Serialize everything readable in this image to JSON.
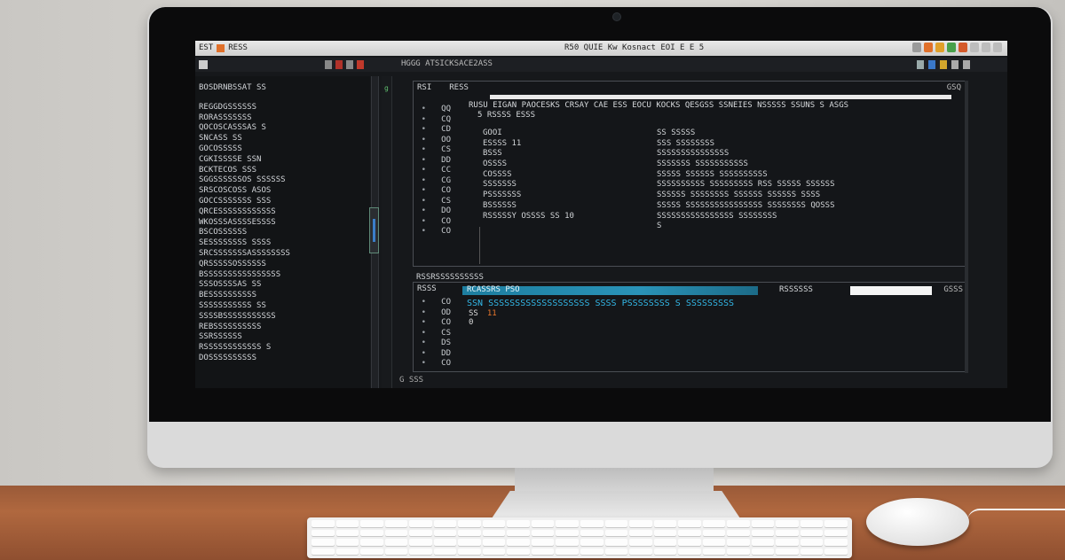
{
  "window": {
    "title_left": "EST",
    "title_left_2": "RESS",
    "title_center": "R50  QUIE Kw Kosnact EOI E E 5"
  },
  "menubar": {
    "left_label": "",
    "path": "HGGG ATSICKSACE2ASS"
  },
  "left_panel": {
    "header": "BOSDRNBSSAT SS",
    "lines": [
      "REGGDGSSSSSS",
      "RORASSSSSSS",
      "QOCOSCASSSAS S",
      "SNCASS SS",
      "GOCOSSSSS",
      "CGKISSSSE SSN",
      "BCKTECOS SSS",
      "SGGSSSSSSOS SSSSSS",
      "SRSCOSCOSS ASOS",
      "GOCCSSSSSSS SSS",
      "QRCESSSSSSSSSSSS",
      "WKOSSSASSSSESSSS",
      "BSCOSSSSSS",
      "SESSSSSSSS SSSS",
      "SRCSSSSSSSASSSSSSSS",
      "QRSSSSSOSSSSSS",
      "BSSSSSSSSSSSSSSSS",
      "SSSOSSSSAS SS",
      "BESSSSSSSSSS",
      "SSSSSSSSSSS SS",
      "SSSSBSSSSSSSSSSS",
      "REBSSSSSSSSSS",
      "SSRSSSSSS",
      "RSSSSSSSSSSSS S",
      "DOSSSSSSSSSS"
    ]
  },
  "editor": {
    "tab_1": "RSI",
    "tab_2": "RESS",
    "corner": "GSQ",
    "header": "RUSU  EIGAN  PAOCESKS  CRSAY  CAE  ESS  EOCU  KOCKS  QESGSS  SSNEIES  NSSSSS  SSUNS S  ASGS",
    "sub": "5  RSSSS  ESSS",
    "line_numbers": [
      "QQ",
      "CQ",
      "CD",
      "OO",
      "CS",
      "DD",
      "CC",
      "CG",
      "CO",
      "CS",
      "DO",
      "CO",
      "CO"
    ],
    "col1": [
      "GOOI",
      "ESSSS  11",
      "BSSS",
      "OSSSS",
      "COSSSS",
      "SSSSSSS",
      "PSSSSSSS",
      "BSSSSSS",
      "RSSSSSY  OSSSS  SS  10"
    ],
    "col2": [
      "SS  SSSSS",
      "SSS  SSSSSSSS",
      "SSSSSSSSSSSSSSS",
      "SSSSSSS  SSSSSSSSSSS",
      "SSSSS  SSSSSS  SSSSSSSSSS",
      "SSSSSSSSSS  SSSSSSSSS  RSS  SSSSS  SSSSSS",
      "SSSSSS  SSSSSSSS  SSSSSS  SSSSSS  SSSS",
      "SSSSS  SSSSSSSSSSSSSSSS  SSSSSSSS  QOSSS",
      "SSSSSSSSSSSSSSSS  SSSSSSSS",
      "S"
    ]
  },
  "console": {
    "label": "RSSRSSSSSSSSSS",
    "top_left": "RSSS",
    "highlight": "RCASSRS  PSO",
    "highlight_right": "RSSSSSS",
    "corner": "GSSS",
    "line_numbers": [
      "CO",
      "OD",
      "CO",
      "CS",
      "DS",
      "DD",
      "CO"
    ],
    "output": "SSN  SSSSSSSSSSSSSSSSSSS  SSSS  PSSSSSSSS  S  SSSSSSSSS",
    "line2": "SS",
    "line2_orange": "11",
    "line3": "0"
  },
  "status": {
    "left": "G  SSS"
  },
  "colors": {
    "screen_bg": "#16181b",
    "highlight_bar": "#2a93b8",
    "console_text": "#33b8e8",
    "accent_orange": "#e8772c"
  }
}
